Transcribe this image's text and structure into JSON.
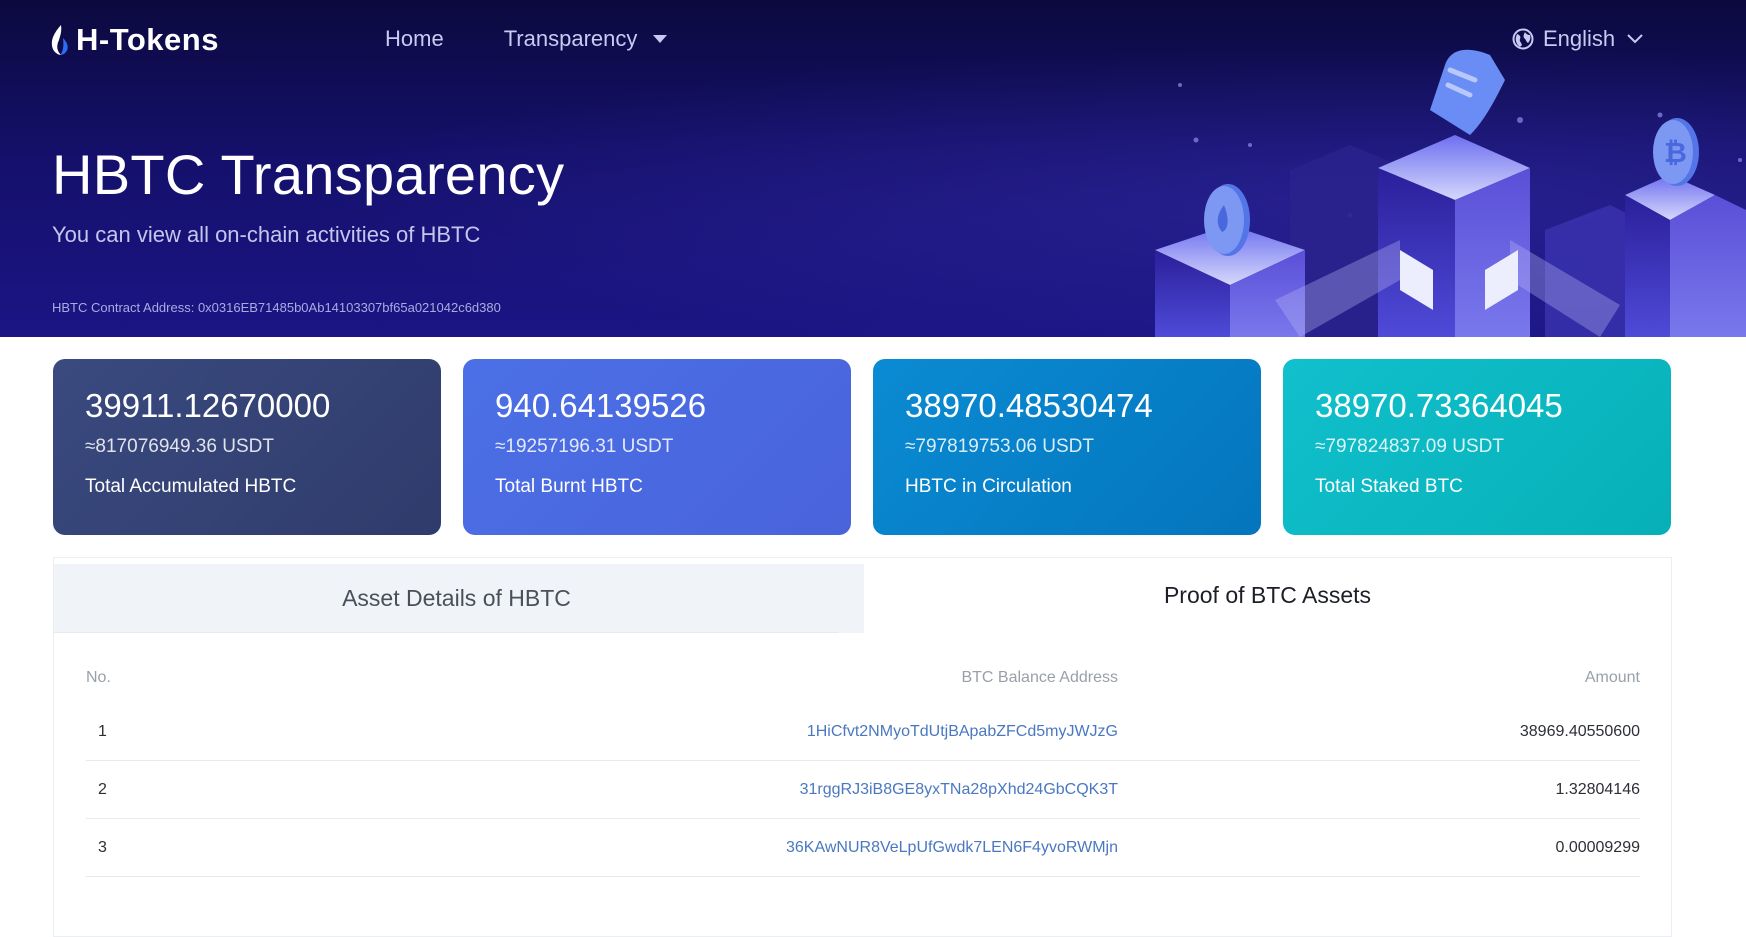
{
  "header": {
    "logo_text": "H-Tokens",
    "nav": [
      {
        "label": "Home"
      },
      {
        "label": "Transparency",
        "has_dropdown": true
      }
    ],
    "language": "English"
  },
  "hero": {
    "title": "HBTC Transparency",
    "subtitle": "You can view all on-chain activities of HBTC",
    "contract_address": "HBTC Contract Address: 0x0316EB71485b0Ab14103307bf65a021042c6d380"
  },
  "cards": [
    {
      "value": "39911.12670000",
      "usdt": "≈817076949.36 USDT",
      "label": "Total Accumulated HBTC",
      "color": "#34416f"
    },
    {
      "value": "940.64139526",
      "usdt": "≈19257196.31 USDT",
      "label": "Total Burnt HBTC",
      "color": "#4a6ae1"
    },
    {
      "value": "38970.48530474",
      "usdt": "≈797819753.06 USDT",
      "label": "HBTC in Circulation",
      "color": "#0780c6"
    },
    {
      "value": "38970.73364045",
      "usdt": "≈797824837.09 USDT",
      "label": "Total Staked BTC",
      "color": "#0cb8c2"
    }
  ],
  "tabs": [
    {
      "label": "Asset Details of HBTC",
      "active": false
    },
    {
      "label": "Proof of BTC Assets",
      "active": true
    }
  ],
  "table": {
    "columns": [
      "No.",
      "BTC Balance Address",
      "Amount"
    ],
    "rows": [
      {
        "no": "1",
        "address": "1HiCfvt2NMyoTdUtjBApabZFCd5myJWJzG",
        "amount": "38969.40550600"
      },
      {
        "no": "2",
        "address": "31rggRJ3iB8GE8yxTNa28pXhd24GbCQK3T",
        "amount": "1.32804146"
      },
      {
        "no": "3",
        "address": "36KAwNUR8VeLpUfGwdk7LEN6F4yvoRWMjn",
        "amount": "0.00009299"
      }
    ]
  },
  "icons": {
    "logo": "flame-logo-icon",
    "language": "globe-icon",
    "language_chevron": "chevron-down-icon",
    "nav_caret": "caret-down-icon"
  }
}
